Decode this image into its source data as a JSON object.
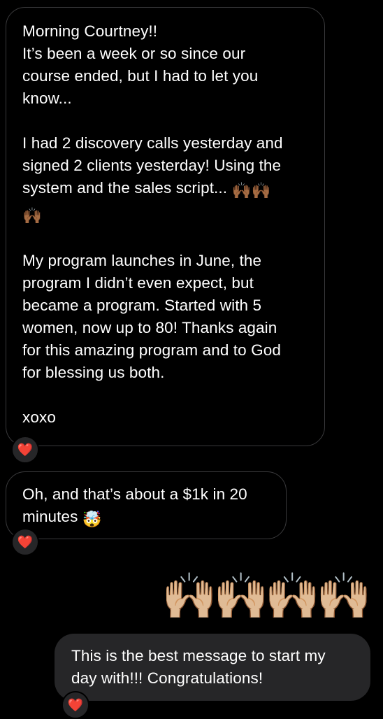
{
  "messages": [
    {
      "direction": "received",
      "lines": [
        "Morning Courtney!!",
        "It’s been a week or so since our",
        "course ended, but I had to let you",
        "know...",
        "",
        "I had 2 discovery calls yesterday and",
        "signed 2 clients yesterday! Using the",
        "system and the sales script...",
        "",
        "",
        "My program launches in June, the",
        "program I didn’t even expect, but",
        "became a program. Started with 5",
        "women, now up to 80! Thanks again",
        "for this amazing program and to God",
        "for blessing us both.",
        "",
        "xoxo"
      ],
      "inline_emoji": "🙌🏾🙌🏾",
      "inline_emoji_2": "🙌🏾",
      "reaction": "❤️"
    },
    {
      "direction": "received",
      "lines": [
        "Oh, and that’s about a $1k in 20",
        "minutes"
      ],
      "inline_emoji": "🤯",
      "reaction": "❤️"
    },
    {
      "direction": "sent",
      "emoji_only": "🙌🏼🙌🏼🙌🏼🙌🏼"
    },
    {
      "direction": "sent",
      "lines": [
        "This is the best message to start my",
        "day with!!! Congratulations!"
      ],
      "reaction": "❤️"
    }
  ],
  "colors": {
    "background": "#000000",
    "received_border": "#3a3a3c",
    "sent_bubble": "#262628",
    "heart": "#ff2d4d"
  }
}
